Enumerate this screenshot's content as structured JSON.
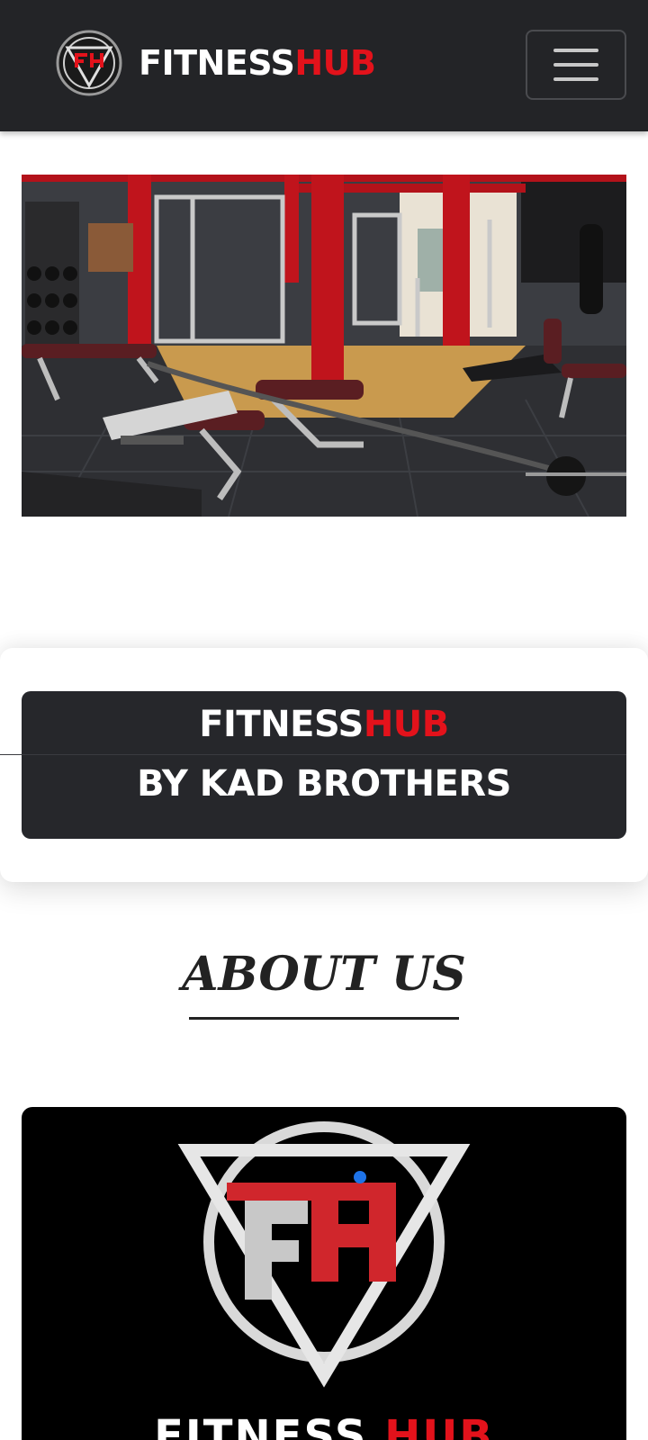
{
  "navbar": {
    "brand_part1": "FITNESS",
    "brand_part2": "HUB",
    "logo_icon": "fh-logo-icon",
    "menu_icon": "hamburger-menu-icon"
  },
  "hero": {
    "image_desc": "gym-interior-photo"
  },
  "banner": {
    "line1_part1": "FITNESS",
    "line1_part2": "HUB",
    "line2": "BY KAD BROTHERS"
  },
  "about": {
    "title": "ABOUT US"
  },
  "logo_block": {
    "word1": "FITNESS",
    "word2": "HUB"
  },
  "colors": {
    "brand_red": "#e3121b",
    "dark": "#232427"
  }
}
